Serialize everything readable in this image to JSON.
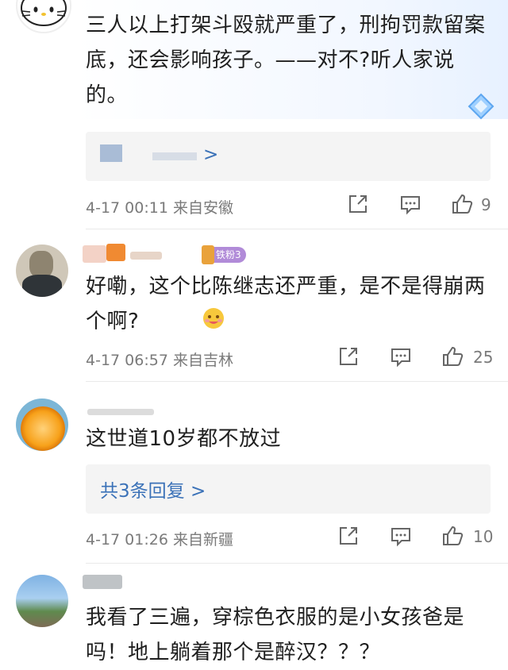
{
  "comments": [
    {
      "text": "三人以上打架斗殴就严重了，刑拘罚款留案底，还会影响孩子。——对不?听人家说的。",
      "reply_label": ">",
      "meta": "4-17 00:11  来自安徽",
      "likes": "9"
    },
    {
      "badge": "铁粉3",
      "text": "好嘞，这个比陈继志还严重，是不是得崩两个啊?",
      "meta": "4-17 06:57  来自吉林",
      "likes": "25"
    },
    {
      "text": "这世道10岁都不放过",
      "reply_label": "共3条回复 >",
      "meta": "4-17 01:26  来自新疆",
      "likes": "10"
    },
    {
      "text": "我看了三遍，穿棕色衣服的是小女孩爸是吗！地上躺着那个是醉汉？？？"
    }
  ],
  "icons": {
    "share": "share-icon",
    "comment": "comment-icon",
    "like": "thumbs-up-icon"
  }
}
